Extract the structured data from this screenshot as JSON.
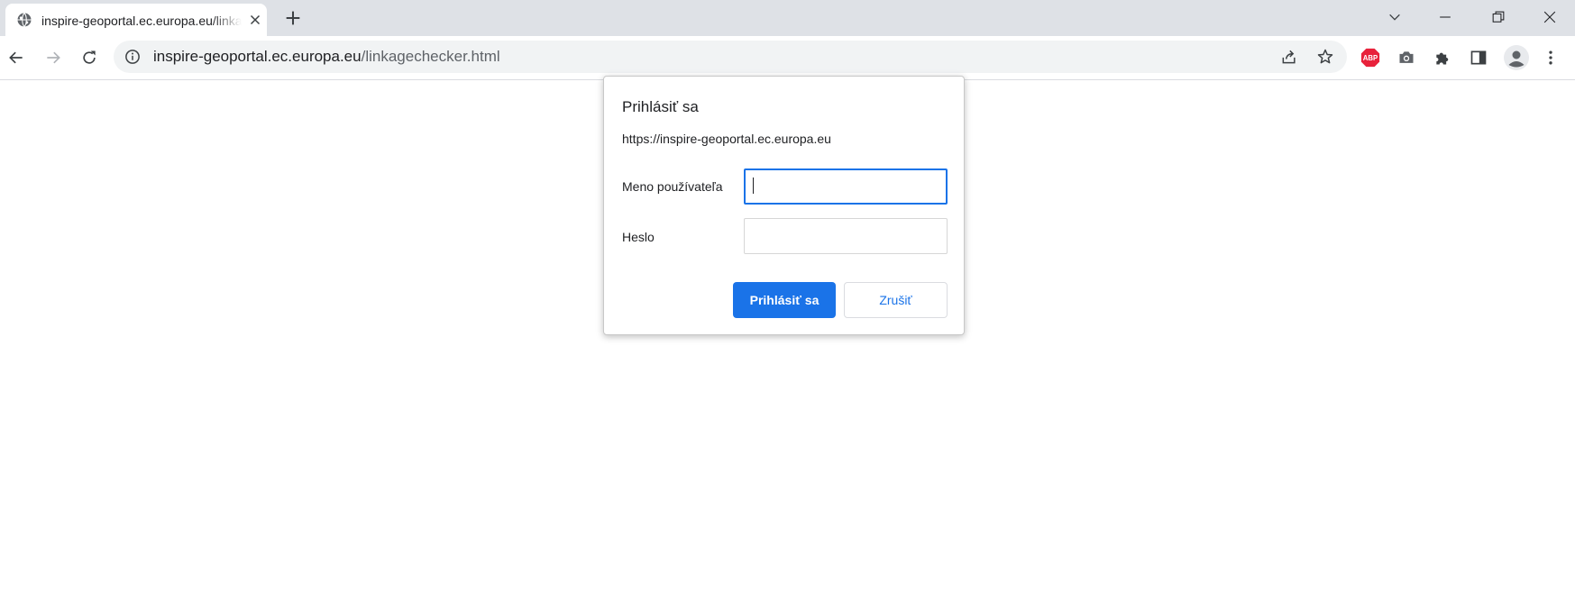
{
  "tab": {
    "title": "inspire-geoportal.ec.europa.eu/linkagechecker.html",
    "favicon": "globe-icon",
    "close_icon": "close-icon"
  },
  "window_controls": [
    "tab-search-icon",
    "minimize-icon",
    "restore-icon",
    "close-window-icon"
  ],
  "toolbar": {
    "back_icon": "back-arrow-icon",
    "forward_icon": "forward-arrow-icon",
    "reload_icon": "reload-icon",
    "site_info_icon": "info-icon",
    "url_host": "inspire-geoportal.ec.europa.eu",
    "url_path": "/linkagechecker.html",
    "share_icon": "share-icon",
    "bookmark_icon": "star-icon",
    "extensions": {
      "abp_label": "ABP",
      "abp_color": "#e8223b",
      "camera_icon": "camera-icon",
      "puzzle_icon": "puzzle-icon",
      "side_panel_icon": "side-panel-icon",
      "profile_icon": "profile-icon",
      "menu_icon": "kebab-menu-icon"
    }
  },
  "dialog": {
    "title": "Prihlásiť sa",
    "origin": "https://inspire-geoportal.ec.europa.eu",
    "username_label": "Meno používateľa",
    "username_value": "",
    "password_label": "Heslo",
    "password_value": "",
    "sign_in_button": "Prihlásiť sa",
    "cancel_button": "Zrušiť",
    "accent_color": "#1a73e8"
  }
}
